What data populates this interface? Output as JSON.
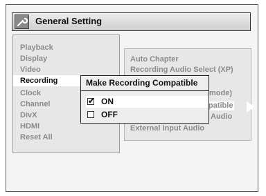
{
  "header": {
    "title": "General Setting",
    "icon": "wrench-icon"
  },
  "menu": {
    "items": [
      "Playback",
      "Display",
      "Video",
      "Recording",
      "Clock",
      "Channel",
      "DivX",
      "HDMI",
      "Reset All"
    ],
    "selected": "Recording"
  },
  "submenu": {
    "items": [
      "Auto Chapter",
      "Recording Audio Select (XP)",
      "mode)",
      "patible",
      "Audio",
      "External Input Audio"
    ]
  },
  "dialog": {
    "title": "Make Recording Compatible",
    "options": [
      {
        "label": "ON",
        "checked": true,
        "check_glyph": "✔"
      },
      {
        "label": "OFF",
        "checked": false,
        "check_glyph": ""
      }
    ]
  }
}
